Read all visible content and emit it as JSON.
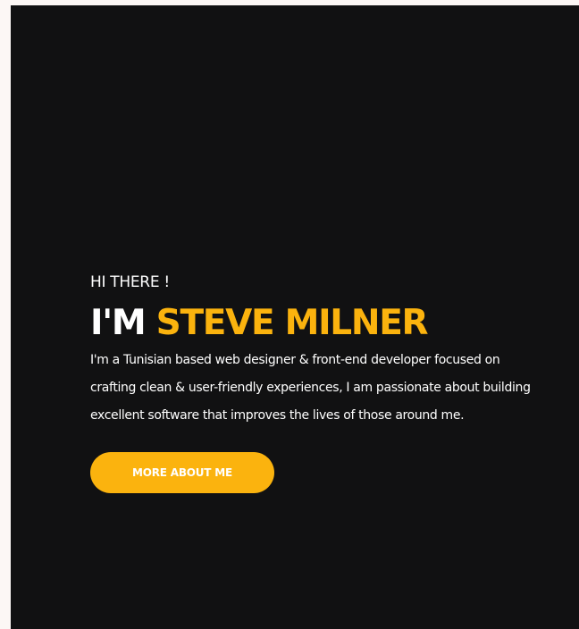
{
  "hero": {
    "greeting": "HI THERE !",
    "headline_prefix": "I'M",
    "headline_name": "STEVE MILNER",
    "bio_lines": [
      "I'm a Tunisian based web designer & front-end developer focused on",
      "crafting clean & user-friendly experiences, I am passionate about building",
      "excellent software that improves the lives of those around me."
    ],
    "cta_label": "MORE ABOUT ME"
  },
  "colors": {
    "background": "#111112",
    "accent": "#fbb30e",
    "text": "#ffffff",
    "page_border": "#fcf7f5"
  }
}
